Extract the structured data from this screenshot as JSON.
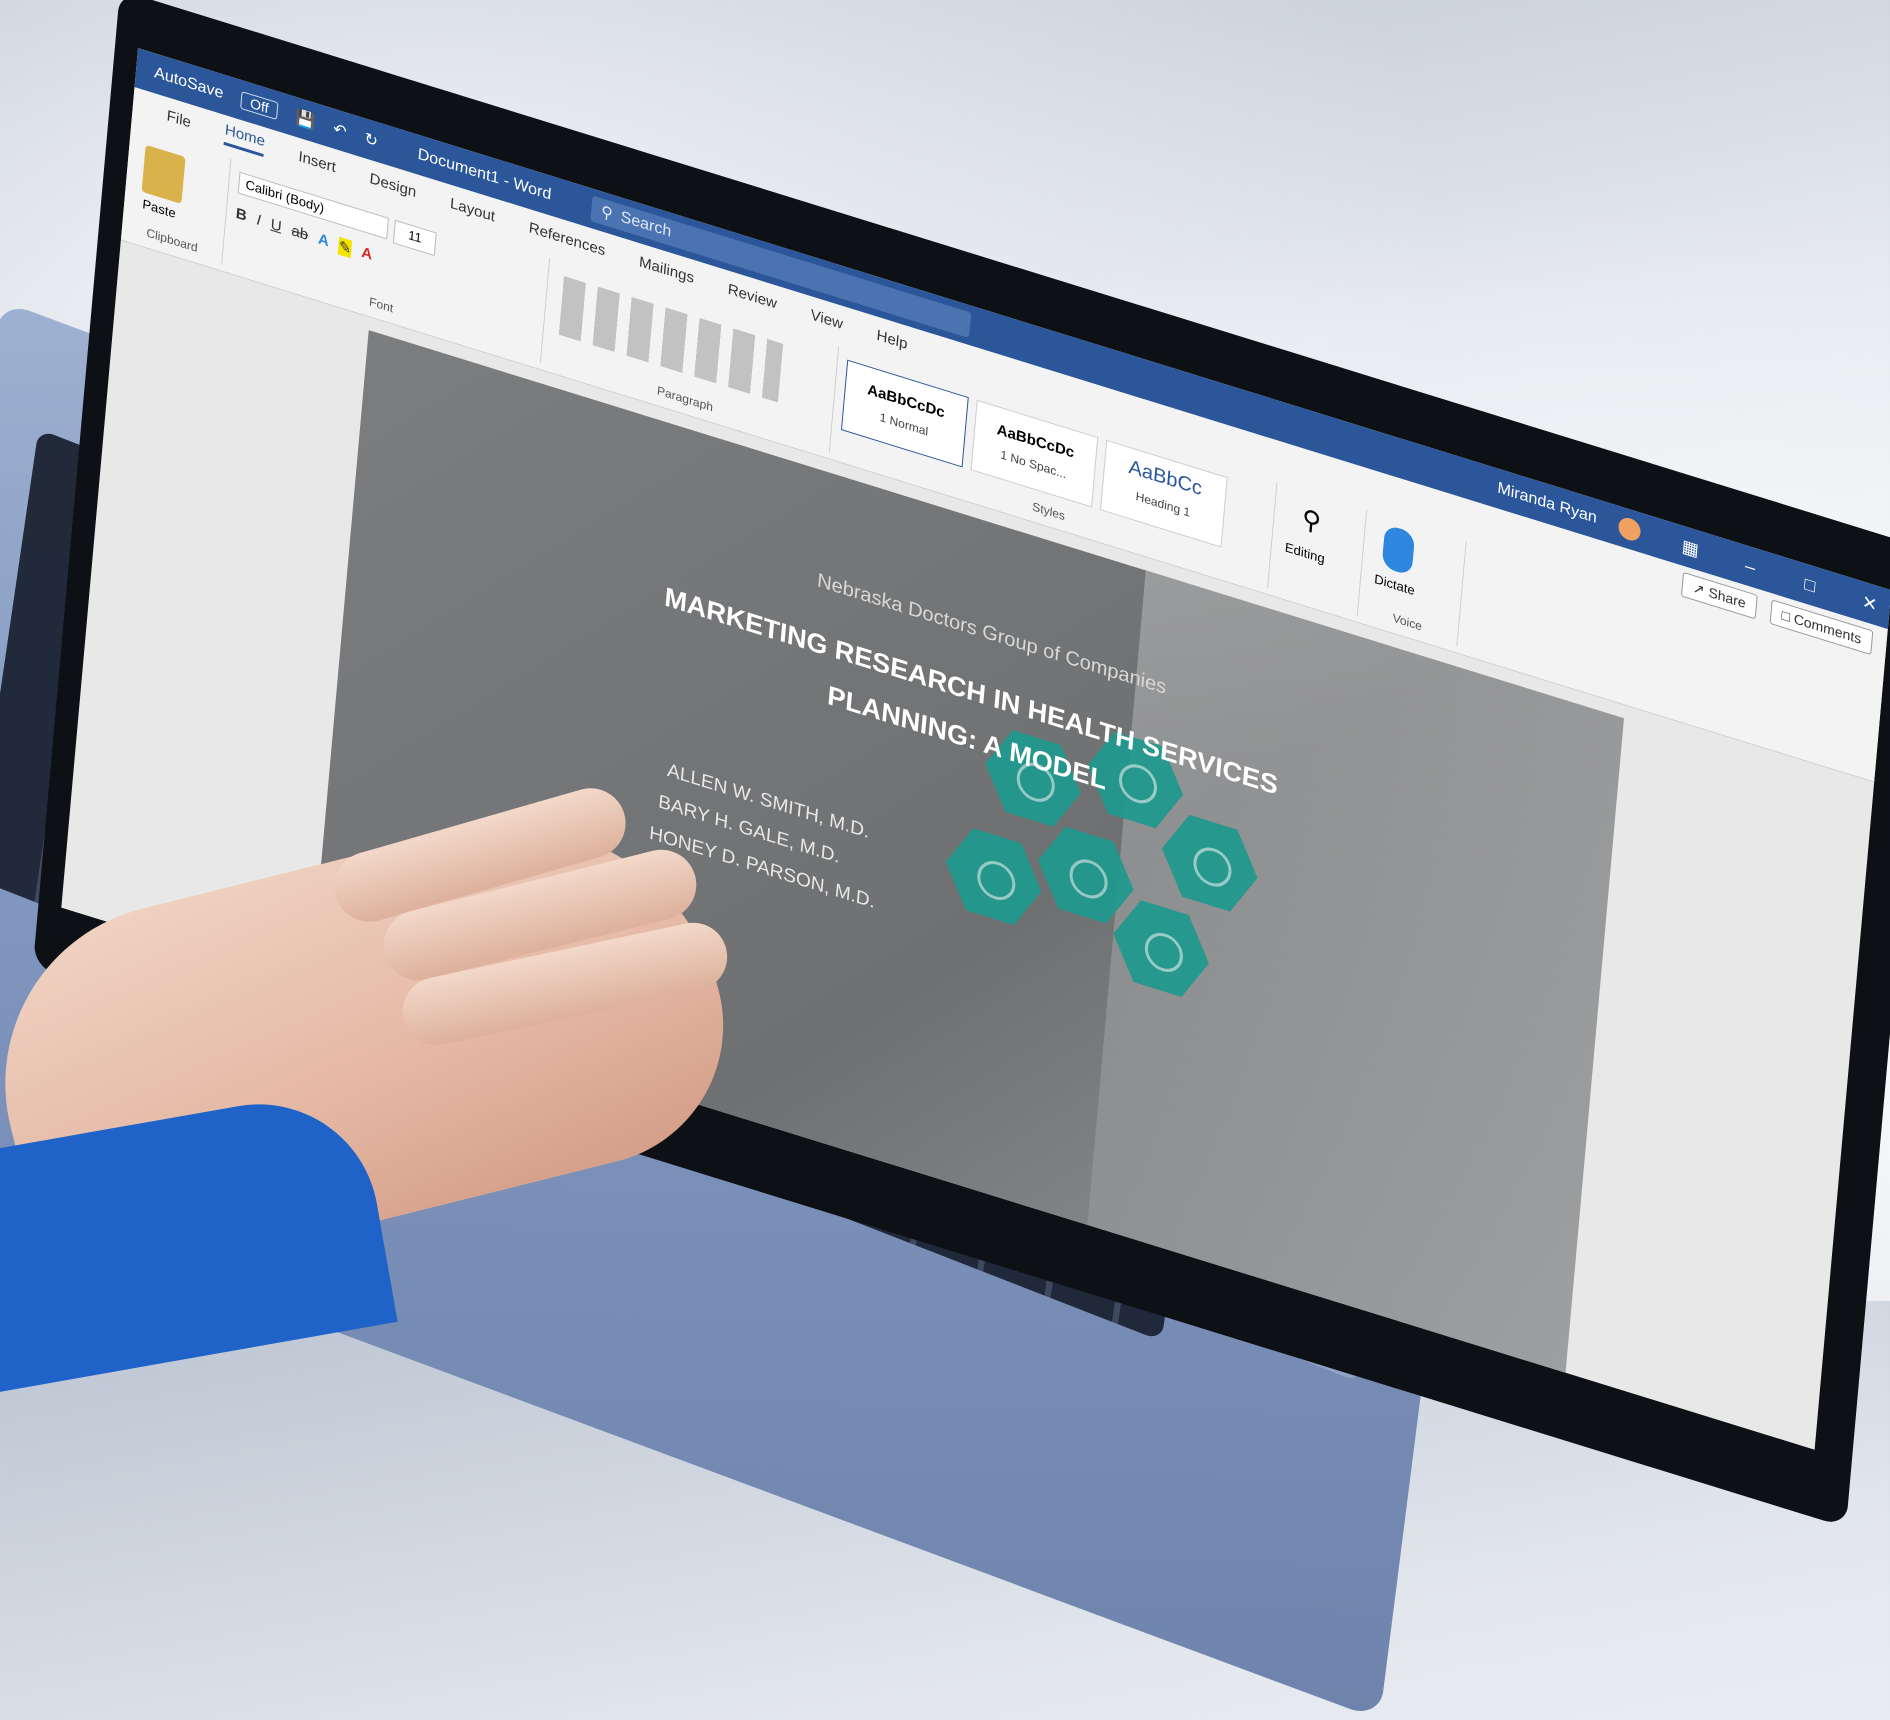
{
  "word": {
    "autosave_label": "AutoSave",
    "autosave_state": "Off",
    "document_title": "Document1 - Word",
    "search_placeholder": "Search",
    "user_name": "Miranda Ryan",
    "tabs": [
      "File",
      "Home",
      "Insert",
      "Design",
      "Layout",
      "References",
      "Mailings",
      "Review",
      "View",
      "Help"
    ],
    "active_tab": "Home",
    "share_label": "Share",
    "comments_label": "Comments",
    "ribbon": {
      "paste_label": "Paste",
      "clipboard_label": "Clipboard",
      "font_name": "Calibri (Body)",
      "font_size": "11",
      "font_group_label": "Font",
      "paragraph_group_label": "Paragraph",
      "styles": [
        {
          "sample": "AaBbCcDc",
          "name": "1 Normal"
        },
        {
          "sample": "AaBbCcDc",
          "name": "1 No Spac..."
        },
        {
          "sample": "AaBbCc",
          "name": "Heading 1"
        }
      ],
      "styles_group_label": "Styles",
      "editing_label": "Editing",
      "dictate_label": "Dictate",
      "voice_group_label": "Voice"
    }
  },
  "document": {
    "company": "Nebraska Doctors Group of Companies",
    "title_line1": "MARKETING RESEARCH IN HEALTH SERVICES",
    "title_line2": "PLANNING: A MODEL",
    "authors": [
      "ALLEN W. SMITH, M.D.",
      "BARY H. GALE, M.D.",
      "HONEY D. PARSON, M.D."
    ]
  },
  "colors": {
    "word_blue": "#2b579a",
    "hex_teal": "#1f9a8e",
    "sleeve_blue": "#1f63c9"
  }
}
